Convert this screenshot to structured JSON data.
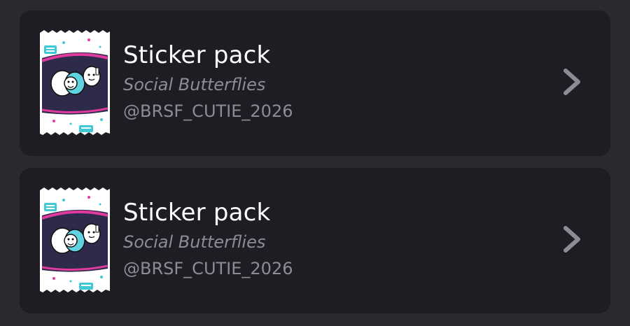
{
  "items": [
    {
      "title": "Sticker pack",
      "subtitle": "Social Butterflies",
      "handle": "@BRSF_CUTIE_2026",
      "icon": "sticker-pack-thumbnail",
      "chevron_icon": "chevron-right-icon"
    },
    {
      "title": "Sticker pack",
      "subtitle": "Social Butterflies",
      "handle": "@BRSF_CUTIE_2026",
      "icon": "sticker-pack-thumbnail",
      "chevron_icon": "chevron-right-icon"
    }
  ],
  "colors": {
    "background": "#2b2830",
    "card": "#1f1c23",
    "title": "#ffffff",
    "secondary": "#8f8b96",
    "accent_teal": "#3fc8d6",
    "accent_pink": "#e03aa0"
  }
}
